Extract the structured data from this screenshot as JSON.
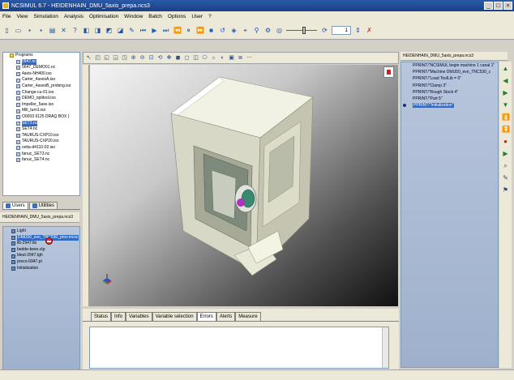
{
  "window": {
    "title": "NCSIMUL 6.7 - HEIDENHAIN_DMU_5axis_prepa.ncs3"
  },
  "menu": [
    "File",
    "View",
    "Simulation",
    "Analysis",
    "Optimisation",
    "Window",
    "Batch",
    "Options",
    "User",
    "?"
  ],
  "toolbar": {
    "spin_value": "1"
  },
  "tree": {
    "items": [
      {
        "label": "Programs",
        "folder": true,
        "indent": 1
      },
      {
        "label": "0947.nc",
        "folder": false,
        "indent": 2,
        "selected": true
      },
      {
        "label": "5647_DEMO01.nc",
        "folder": false,
        "indent": 2
      },
      {
        "label": "4axis-NH400.iso",
        "folder": false,
        "indent": 2
      },
      {
        "label": "Carter_4axesA.iso",
        "folder": false,
        "indent": 2
      },
      {
        "label": "Carter_4axesB_probing.iso",
        "folder": false,
        "indent": 2
      },
      {
        "label": "Change-cu-01.iso",
        "folder": false,
        "indent": 2
      },
      {
        "label": "DEMO_optitool.iso",
        "folder": false,
        "indent": 2
      },
      {
        "label": "Impeller_5axe.iso",
        "folder": false,
        "indent": 2
      },
      {
        "label": "Mill_turn1.iso",
        "folder": false,
        "indent": 2
      },
      {
        "label": "O0003 9125 DRAQ BOX )",
        "folder": false,
        "indent": 2
      },
      {
        "label": "SET3.nc",
        "folder": false,
        "indent": 2,
        "highlight": true
      },
      {
        "label": "SET4.nc",
        "folder": false,
        "indent": 2
      },
      {
        "label": "TAURUS-CXP10.iso",
        "folder": false,
        "indent": 2
      },
      {
        "label": "TAURUS-CXP20.iso",
        "folder": false,
        "indent": 2
      },
      {
        "label": "cetta-d4110-02.iso",
        "folder": false,
        "indent": 2
      },
      {
        "label": "fanuc_SET3.nc",
        "folder": false,
        "indent": 2
      },
      {
        "label": "fanuc_SET4.nc",
        "folder": false,
        "indent": 2
      }
    ]
  },
  "left_tabs": [
    "Users",
    "Utilities"
  ],
  "project": {
    "header": "HEIDENHAIN_DMU_5axis_prepa.ncs3",
    "items": [
      {
        "label": "Light"
      },
      {
        "label": "DMU50_evo_TNC530_prov.mcsc",
        "selected": true
      },
      {
        "label": "lib-2947.lib"
      },
      {
        "label": "bedde-beex.ctp"
      },
      {
        "label": "bleul-2947.tgh"
      },
      {
        "label": "preco-0947.pt"
      },
      {
        "label": "Initialization"
      }
    ]
  },
  "bottom_tabs": [
    "Status",
    "Info",
    "Variables",
    "Variable selection",
    "Errors",
    "Alerts",
    "Measure"
  ],
  "bottom_active": "Errors",
  "ncprogram": {
    "header": "HEIDENHAIN_DMU_5axis_prepa.ncs3",
    "lines": [
      {
        "text": "PPRINT/\"NCSIMUL begin machine 1 canal 1\""
      },
      {
        "text": "PPRINT/\"Machine DMU50_evo_TNC530_c"
      },
      {
        "text": "PPRINT/\"Load ToolLib = 0\""
      },
      {
        "text": "PPRINT/\"Clamp 3\""
      },
      {
        "text": "PPRINT/\"Rough Stock 4\""
      },
      {
        "text": "PPRINT/\"Part 5\""
      },
      {
        "text": "PPRINT/\"Initialization\"",
        "selected": true
      }
    ]
  }
}
